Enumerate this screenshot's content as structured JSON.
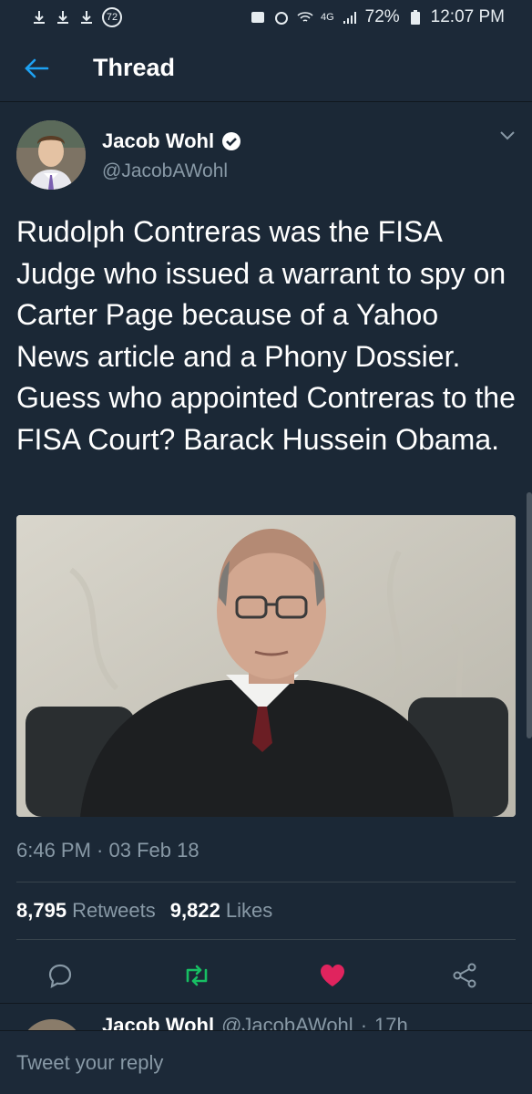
{
  "status_bar": {
    "badge_count": "72",
    "network": "4G",
    "battery": "72%",
    "time": "12:07 PM"
  },
  "app_bar": {
    "title": "Thread"
  },
  "tweet": {
    "author_name": "Jacob Wohl",
    "author_handle": "@JacobAWohl",
    "verified": true,
    "text": "Rudolph Contreras was the FISA Judge who issued a warrant to spy on Carter Page because of a Yahoo News article and a Phony Dossier. Guess who appointed Contreras to the FISA Court? Barack Hussein Obama.",
    "timestamp": "6:46 PM · 03 Feb 18",
    "retweets_count": "8,795",
    "retweets_label": "Retweets",
    "likes_count": "9,822",
    "likes_label": "Likes"
  },
  "next_tweet": {
    "author_name": "Jacob Wohl",
    "author_handle": "@JacobAWohl",
    "age": "17h"
  },
  "reply": {
    "placeholder": "Tweet your reply"
  },
  "colors": {
    "background": "#1b2836",
    "accent": "#1da1f2",
    "retweet": "#17bf63",
    "like": "#e0245e",
    "muted": "#8899a6"
  },
  "icons": [
    "arrow-left-icon",
    "verified-badge-icon",
    "chevron-down-icon",
    "reply-icon",
    "retweet-icon",
    "heart-icon",
    "share-icon"
  ]
}
